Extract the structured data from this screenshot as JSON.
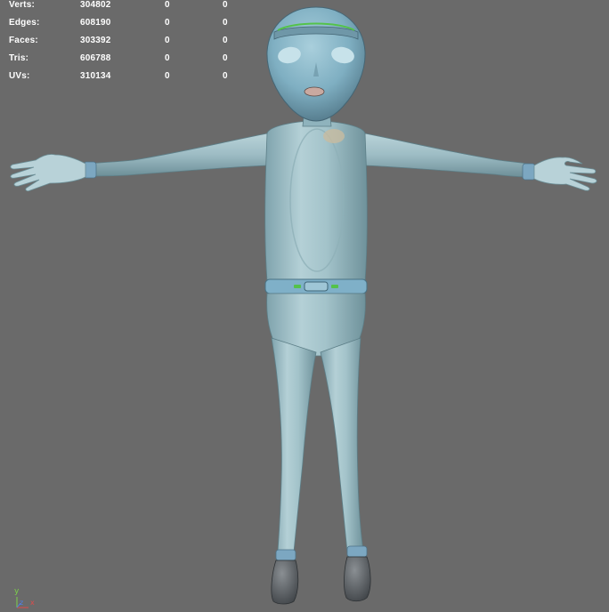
{
  "hud": {
    "rows": [
      {
        "label": "Verts:",
        "v1": "304802",
        "v2": "0",
        "v3": "0"
      },
      {
        "label": "Edges:",
        "v1": "608190",
        "v2": "0",
        "v3": "0"
      },
      {
        "label": "Faces:",
        "v1": "303392",
        "v2": "0",
        "v3": "0"
      },
      {
        "label": "Tris:",
        "v1": "606788",
        "v2": "0",
        "v3": "0"
      },
      {
        "label": "UVs:",
        "v1": "310134",
        "v2": "0",
        "v3": "0"
      }
    ]
  },
  "axis": {
    "y": "y",
    "z": "z",
    "x": "x"
  },
  "colors": {
    "viewport_background": "#6a6a6a",
    "skin": "#9fc2cc",
    "belt_accent": "#54c24a",
    "axis_y": "#7cd04a",
    "axis_z": "#4f7fe6",
    "axis_x": "#e04a4a"
  }
}
